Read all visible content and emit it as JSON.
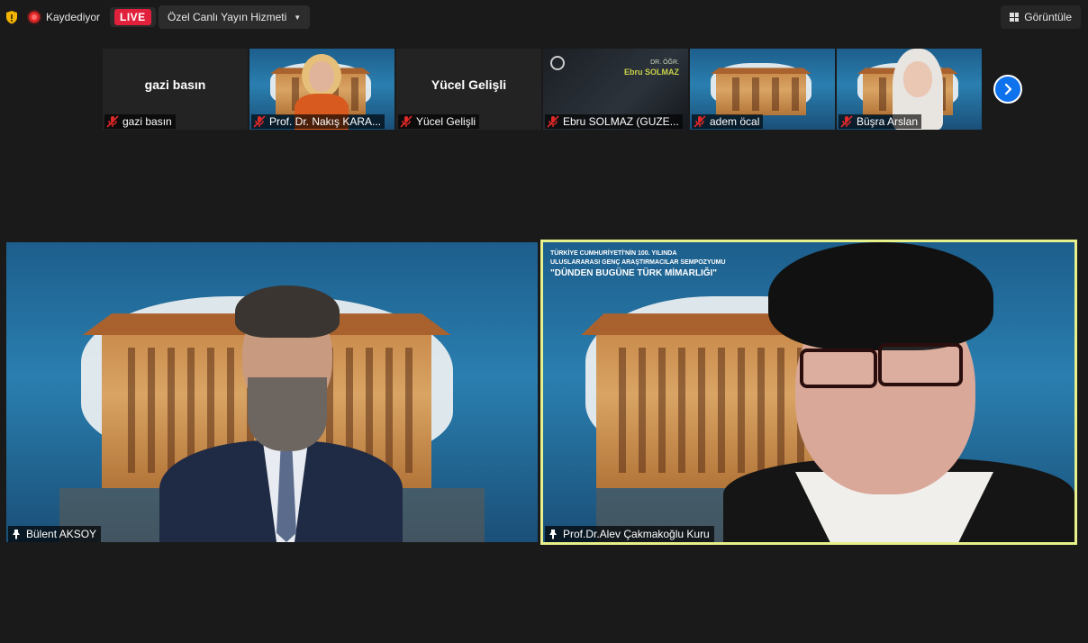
{
  "toolbar": {
    "recording_label": "Kaydediyor",
    "live_label": "LIVE",
    "stream_service_label": "Özel Canlı Yayın Hizmeti",
    "view_label": "Görüntüle"
  },
  "gallery": {
    "thumbnails": [
      {
        "display_name": "gazi basın",
        "label": "gazi basın",
        "muted": true
      },
      {
        "display_name": "",
        "label": "Prof. Dr. Nakış KARA...",
        "muted": true
      },
      {
        "display_name": "Yücel Gelişli",
        "label": "Yücel Gelişli",
        "muted": true
      },
      {
        "display_name": "",
        "label": "Ebru SOLMAZ (GUZE...",
        "muted": true,
        "slide_title": "DR. ÖĞR.",
        "slide_name": "Ebru SOLMAZ"
      },
      {
        "display_name": "",
        "label": "adem öcal",
        "muted": true
      },
      {
        "display_name": "",
        "label": "Büşra Arslan",
        "muted": true
      }
    ]
  },
  "speakers": [
    {
      "name": "Bülent AKSOY"
    },
    {
      "name": "Prof.Dr.Alev Çakmakoğlu Kuru",
      "active": true,
      "banner_line1": "TÜRKİYE CUMHURİYETİ'NİN 100. YILINDA",
      "banner_line2": "ULUSLARARASI GENÇ ARAŞTIRMACILAR SEMPOZYUMU",
      "banner_line3": "\"DÜNDEN BUGÜNE TÜRK MİMARLIĞI\""
    }
  ],
  "colors": {
    "background": "#1a1a1a",
    "live_red": "#e1213c",
    "active_speaker_outline": "#e8f08a",
    "next_button": "#0e72ed"
  }
}
